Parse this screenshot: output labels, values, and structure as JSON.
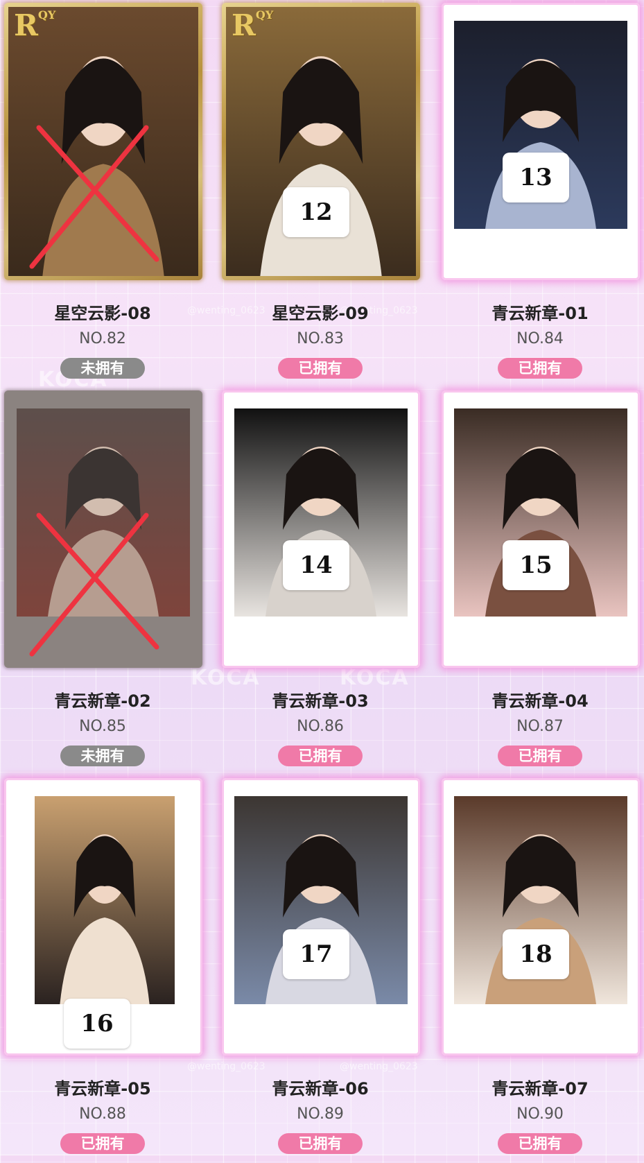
{
  "watermark": {
    "brand": "KOCA",
    "handle": "@wenting_0623"
  },
  "logo": {
    "letter": "R",
    "suffix": "QY"
  },
  "cards": [
    {
      "name": "星空云影-08",
      "no": "NO.82",
      "status": "未拥有",
      "owned": false,
      "number": "",
      "crossed": true,
      "frame": "gold"
    },
    {
      "name": "星空云影-09",
      "no": "NO.83",
      "status": "已拥有",
      "owned": true,
      "number": "12",
      "crossed": false,
      "frame": "gold"
    },
    {
      "name": "青云新章-01",
      "no": "NO.84",
      "status": "已拥有",
      "owned": true,
      "number": "13",
      "crossed": false,
      "frame": "white"
    },
    {
      "name": "青云新章-02",
      "no": "NO.85",
      "status": "未拥有",
      "owned": false,
      "number": "",
      "crossed": true,
      "frame": "dim"
    },
    {
      "name": "青云新章-03",
      "no": "NO.86",
      "status": "已拥有",
      "owned": true,
      "number": "14",
      "crossed": false,
      "frame": "white"
    },
    {
      "name": "青云新章-04",
      "no": "NO.87",
      "status": "已拥有",
      "owned": true,
      "number": "15",
      "crossed": false,
      "frame": "white"
    },
    {
      "name": "青云新章-05",
      "no": "NO.88",
      "status": "已拥有",
      "owned": true,
      "number": "16",
      "crossed": false,
      "frame": "white"
    },
    {
      "name": "青云新章-06",
      "no": "NO.89",
      "status": "已拥有",
      "owned": true,
      "number": "17",
      "crossed": false,
      "frame": "white"
    },
    {
      "name": "青云新章-07",
      "no": "NO.90",
      "status": "已拥有",
      "owned": true,
      "number": "18",
      "crossed": false,
      "frame": "white"
    }
  ],
  "colors": {
    "owned": "#f07aa8",
    "not_owned": "#8a8a8a",
    "cross": "#ee3340",
    "glow": "#f08cdc"
  }
}
